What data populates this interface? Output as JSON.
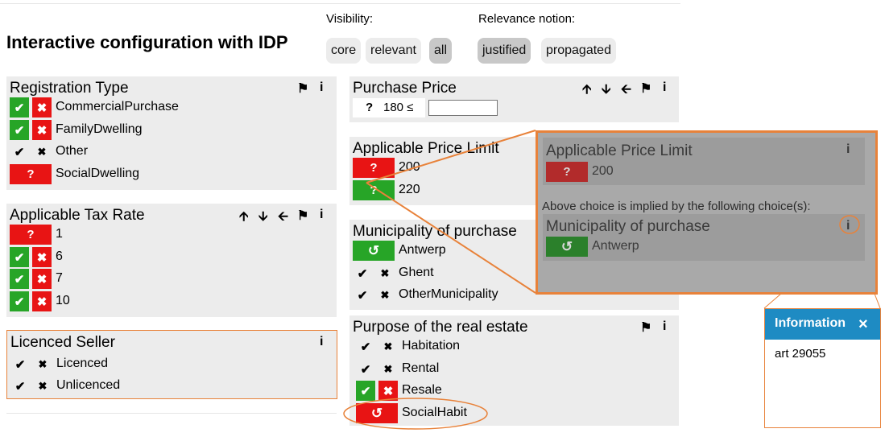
{
  "header": {
    "title": "Interactive configuration with IDP",
    "visibility_label": "Visibility:",
    "visibility_options": [
      "core",
      "relevant",
      "all"
    ],
    "relevance_label": "Relevance notion:",
    "relevance_options": [
      "justified",
      "propagated"
    ]
  },
  "panels": {
    "registration_type": {
      "title": "Registration Type",
      "options": [
        "CommercialPurchase",
        "FamilyDwelling",
        "Other",
        "SocialDwelling"
      ]
    },
    "tax_rate": {
      "title": "Applicable Tax Rate",
      "options": [
        "1",
        "6",
        "7",
        "10"
      ]
    },
    "licenced_seller": {
      "title": "Licenced Seller",
      "options": [
        "Licenced",
        "Unlicenced"
      ]
    },
    "purchase_price": {
      "title": "Purchase Price",
      "constraint": "180 ≤",
      "input_value": ""
    },
    "price_limit": {
      "title": "Applicable Price Limit",
      "options": [
        "200",
        "220"
      ]
    },
    "municipality": {
      "title": "Municipality of purchase",
      "options": [
        "Antwerp",
        "Ghent",
        "OtherMunicipality"
      ]
    },
    "purpose": {
      "title": "Purpose of the real estate",
      "options": [
        "Habitation",
        "Rental",
        "Resale",
        "SocialHabit"
      ]
    }
  },
  "explanation": {
    "title": "Applicable Price Limit",
    "value": "200",
    "implied_text": "Above choice is implied by the following choice(s):",
    "source_title": "Municipality of purchase",
    "source_value": "Antwerp"
  },
  "info_popup": {
    "title": "Information",
    "close": "×",
    "content": "art 29055"
  },
  "icons": {
    "check": "✔",
    "cross": "✖",
    "question": "?",
    "undo": "↺",
    "up": "🡩",
    "down": "🡫",
    "left": "🡨",
    "flag": "⚑",
    "info": "i"
  },
  "colors": {
    "green": "#27a527",
    "red": "#e81414",
    "panel_bg": "#ececec",
    "highlight": "#e8823a",
    "info_header": "#1e8bc3"
  }
}
